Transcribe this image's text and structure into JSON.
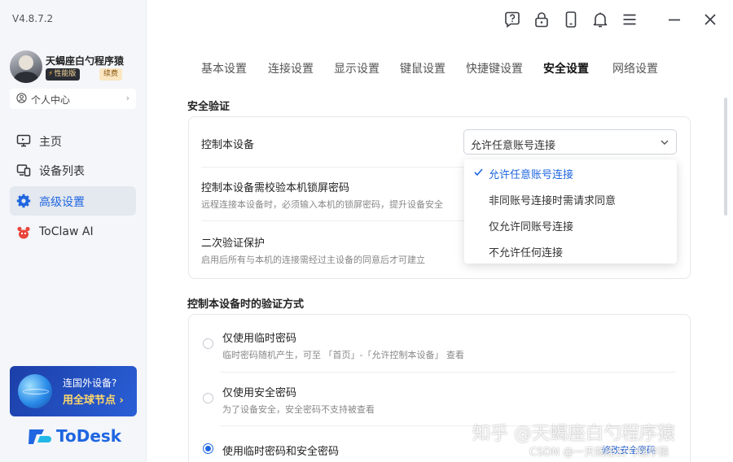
{
  "app": {
    "version": "V4.8.7.2",
    "logo_text": "ToDesk"
  },
  "user": {
    "name": "天蝎座白勺程序猿",
    "tier_badge": "性能版",
    "renew_badge": "续费",
    "personal_center": "个人中心"
  },
  "sidebar": {
    "items": [
      {
        "label": "主页",
        "icon": "monitor-icon"
      },
      {
        "label": "设备列表",
        "icon": "devices-icon"
      },
      {
        "label": "高级设置",
        "icon": "gear-icon",
        "active": true
      },
      {
        "label": "ToClaw AI",
        "icon": "claw-icon"
      }
    ],
    "promo": {
      "line1": "连国外设备?",
      "line2": "用全球节点 ›"
    }
  },
  "topbar": {
    "icons": [
      "help-icon",
      "lock-icon",
      "phone-icon",
      "bell-icon",
      "menu-icon",
      "minimize-icon",
      "close-icon"
    ]
  },
  "tabs": [
    {
      "label": "基本设置"
    },
    {
      "label": "连接设置"
    },
    {
      "label": "显示设置"
    },
    {
      "label": "键鼠设置"
    },
    {
      "label": "快捷键设置"
    },
    {
      "label": "安全设置",
      "active": true
    },
    {
      "label": "网络设置"
    }
  ],
  "security": {
    "section_title": "安全验证",
    "control_device": {
      "label": "控制本设备",
      "selected": "允许任意账号连接",
      "options": [
        "允许任意账号连接",
        "非同账号连接时需请求同意",
        "仅允许同账号连接",
        "不允许任何连接"
      ]
    },
    "lock_password": {
      "label": "控制本设备需校验本机锁屏密码",
      "desc": "远程连接本设备时，必须输入本机的锁屏密码，提升设备安全"
    },
    "second_auth": {
      "label": "二次验证保护",
      "desc": "启用后所有与本机的连接需经过主设备的同意后才可建立"
    }
  },
  "verify": {
    "section_title": "控制本设备时的验证方式",
    "options": [
      {
        "label": "仅使用临时密码",
        "desc": "临时密码随机产生，可至 「首页」-「允许控制本设备」 查看",
        "checked": false
      },
      {
        "label": "仅使用安全密码",
        "desc": "为了设备安全，安全密码不支持被查看",
        "checked": false
      },
      {
        "label": "使用临时密码和安全密码",
        "checked": true
      }
    ],
    "change_link": "修改安全密码"
  },
  "watermark": {
    "zhihu": "知乎 @天蝎座白勺程序猿",
    "csdn": "CSDN @一天蝎座白勺程序猿"
  },
  "colors": {
    "accent": "#1f66e0",
    "sidebar_bg": "#f4f6fa"
  }
}
